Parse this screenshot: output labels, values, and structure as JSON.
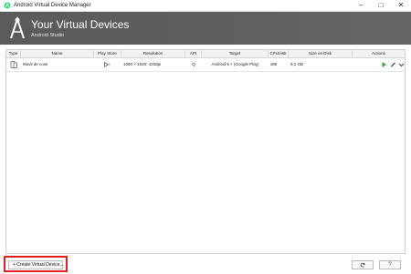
{
  "window": {
    "title": "Android Virtual Device Manager"
  },
  "header": {
    "title": "Your Virtual Devices",
    "subtitle": "Android Studio"
  },
  "table": {
    "columns": [
      "Type",
      "Name",
      "Play Store",
      "Resolution",
      "API",
      "Target",
      "CPU/ABI",
      "Size on Disk",
      "Actions"
    ],
    "rows": [
      {
        "type_icon": "phone-icon",
        "name": "Movil de cose",
        "play_store_icon": "play-store-icon",
        "resolution": "1080 × 1920: 420dpi",
        "api": "Q",
        "target": "Android 9.+ (Google Play)",
        "cpu": "x86",
        "size": "9,1 GB",
        "actions": [
          "run-icon",
          "edit-icon",
          "chevron-down-icon"
        ]
      }
    ]
  },
  "footer": {
    "create_label": "+ Create Virtual Device...",
    "refresh_icon": "refresh-icon",
    "help_label": "?"
  },
  "colors": {
    "header_bg": "#5f5f5f",
    "highlight": "#e41e26",
    "run": "#3aa640"
  }
}
